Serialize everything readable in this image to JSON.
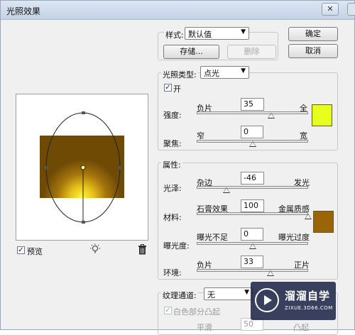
{
  "window": {
    "title": "光照效果",
    "close": "✕"
  },
  "style_group": {
    "label": "样式:",
    "selected": "默认值",
    "save_btn": "存储...",
    "delete_btn": "删除"
  },
  "buttons": {
    "ok": "确定",
    "cancel": "取消"
  },
  "light_group": {
    "type_label": "光照类型:",
    "type_selected": "点光",
    "on_label": "开",
    "on_checked": true,
    "intensity": {
      "label": "强度:",
      "left": "负片",
      "right": "全",
      "value": "35",
      "fraction": 0.67
    },
    "focus": {
      "label": "聚焦:",
      "left": "窄",
      "right": "宽",
      "value": "0",
      "fraction": 0.5
    },
    "light_color": "#e8ff1e"
  },
  "properties_group": {
    "label": "属性:",
    "gloss": {
      "label": "光泽:",
      "left": "杂边",
      "right": "发光",
      "value": "-46",
      "fraction": 0.27
    },
    "material": {
      "label": "材料:",
      "left": "石膏效果",
      "right": "金属质感",
      "value": "100",
      "fraction": 1.0
    },
    "exposure": {
      "label": "曝光度:",
      "left": "曝光不足",
      "right": "曝光过度",
      "value": "0",
      "fraction": 0.5
    },
    "ambience": {
      "label": "环境:",
      "left": "负片",
      "right": "正片",
      "value": "33",
      "fraction": 0.66
    },
    "ambient_color": "#9a6408"
  },
  "texture_group": {
    "label": "纹理通道:",
    "selected": "无",
    "white_high_label": "白色部分凸起",
    "white_high_checked": true,
    "height_left": "平滑",
    "height_right": "凸起",
    "height_value": "50"
  },
  "preview": {
    "checkbox_label": "预览",
    "checked": true
  },
  "icons": {
    "bulb": "light-bulb-icon",
    "trash": "trash-icon"
  },
  "watermark": {
    "title": "溜溜自学",
    "url": "ZIXUE.3D66.COM"
  }
}
